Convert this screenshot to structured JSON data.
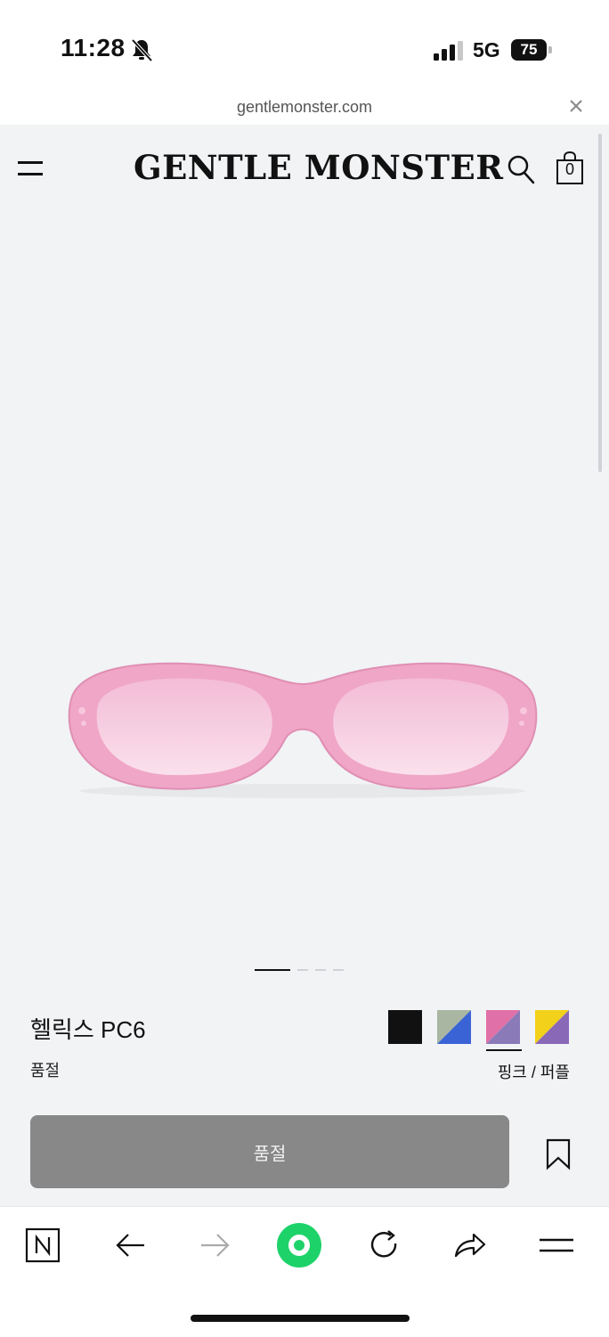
{
  "status_bar": {
    "time": "11:28",
    "network": "5G",
    "battery": "75"
  },
  "browser": {
    "url": "gentlemonster.com"
  },
  "header": {
    "logo": "GENTLE MONSTER",
    "cart_count": "0"
  },
  "product": {
    "name": "헬릭스 PC6",
    "status": "품절",
    "selected_color": "핑크 / 퍼플",
    "image_count": 4,
    "active_image": 1,
    "swatches": [
      {
        "name": "black",
        "colors": [
          "#111111",
          "#111111"
        ]
      },
      {
        "name": "green-blue",
        "colors": [
          "#a8b6a2",
          "#3a63d6"
        ]
      },
      {
        "name": "pink-purple",
        "colors": [
          "#e070a8",
          "#8a7ab8"
        ],
        "selected": true
      },
      {
        "name": "yellow-purple",
        "colors": [
          "#f2d11a",
          "#8a68b8"
        ]
      }
    ],
    "buy_button_label": "품절"
  },
  "colors": {
    "page_bg": "#f1f3f5",
    "button_bg": "#888888",
    "naver_green": "#1ed26a"
  }
}
